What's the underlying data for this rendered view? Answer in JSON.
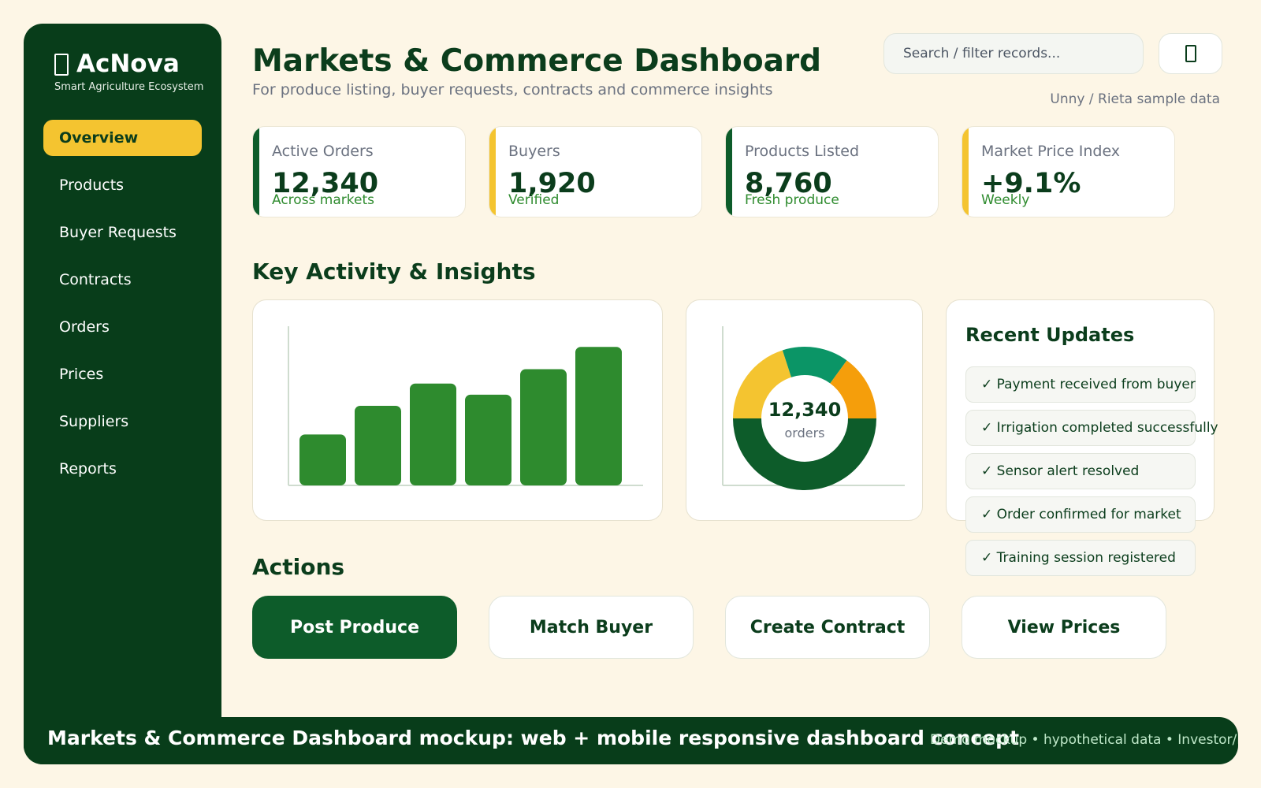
{
  "brand": {
    "name": "AcNova",
    "tagline": "Smart Agriculture Ecosystem",
    "icon": "leaf-icon"
  },
  "nav": [
    {
      "label": "Overview",
      "active": true
    },
    {
      "label": "Products",
      "active": false
    },
    {
      "label": "Buyer Requests",
      "active": false
    },
    {
      "label": "Contracts",
      "active": false
    },
    {
      "label": "Orders",
      "active": false
    },
    {
      "label": "Prices",
      "active": false
    },
    {
      "label": "Suppliers",
      "active": false
    },
    {
      "label": "Reports",
      "active": false
    }
  ],
  "header": {
    "title": "Markets & Commerce Dashboard",
    "subtitle": "For produce listing, buyer requests, contracts and commerce insights",
    "search_placeholder": "Search / filter records...",
    "notification_icon": "bell-icon",
    "sample_note": "Unny / Rieta sample data"
  },
  "stats": [
    {
      "label": "Active Orders",
      "value": "12,340",
      "note": "Across markets",
      "accent": "#0d5c2a"
    },
    {
      "label": "Buyers",
      "value": "1,920",
      "note": "Verified",
      "accent": "#f4c430"
    },
    {
      "label": "Products Listed",
      "value": "8,760",
      "note": "Fresh produce",
      "accent": "#0d5c2a"
    },
    {
      "label": "Market Price Index",
      "value": "+9.1%",
      "note": "Weekly",
      "accent": "#f4c430"
    }
  ],
  "insights_heading": "Key Activity & Insights",
  "chart_data": [
    {
      "type": "bar",
      "title": "",
      "xlabel": "",
      "ylabel": "",
      "categories": [
        "",
        "",
        "",
        "",
        "",
        ""
      ],
      "values": [
        32,
        50,
        64,
        57,
        73,
        87
      ],
      "ylim": [
        0,
        100
      ],
      "color": "#2e8b2e"
    },
    {
      "type": "pie",
      "donut": true,
      "center_value": "12,340",
      "center_label": "orders",
      "slices": [
        {
          "value": 50,
          "color": "#0d5c2a"
        },
        {
          "value": 20,
          "color": "#f4c430"
        },
        {
          "value": 15,
          "color": "#0b9566"
        },
        {
          "value": 15,
          "color": "#f59e0b"
        }
      ]
    }
  ],
  "updates": {
    "title": "Recent Updates",
    "items": [
      "✓ Payment received from buyer",
      "✓ Irrigation completed successfully",
      "✓ Sensor alert resolved",
      "✓ Order confirmed for market",
      "✓ Training session registered"
    ]
  },
  "actions_heading": "Actions",
  "actions": [
    {
      "label": "Post Produce",
      "primary": true
    },
    {
      "label": "Match Buyer",
      "primary": false
    },
    {
      "label": "Create Contract",
      "primary": false
    },
    {
      "label": "View Prices",
      "primary": false
    }
  ],
  "footer": {
    "caption": "Markets & Commerce Dashboard mockup: web + mobile responsive dashboard concept",
    "note": "Demo mockup • hypothetical data • Investor/P"
  }
}
